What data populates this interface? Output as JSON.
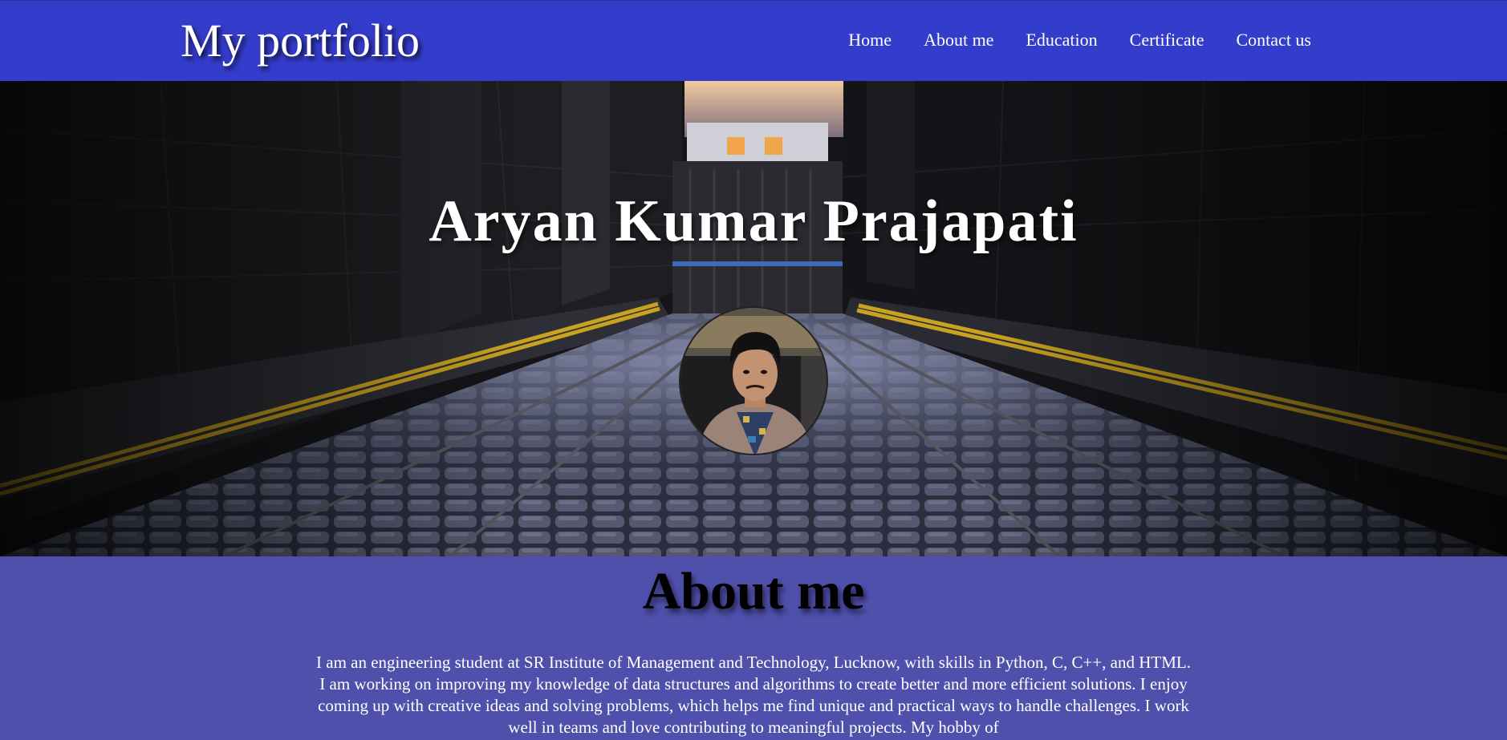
{
  "header": {
    "brand": "My portfolio",
    "nav": [
      {
        "label": "Home"
      },
      {
        "label": "About me"
      },
      {
        "label": "Education"
      },
      {
        "label": "Certificate"
      },
      {
        "label": "Contact us"
      }
    ]
  },
  "hero": {
    "name": "Aryan Kumar Prajapati"
  },
  "about": {
    "title": "About me",
    "text": "I am an engineering student at SR Institute of Management and Technology, Lucknow, with skills in Python, C, C++, and HTML. I am working on improving my knowledge of data structures and algorithms to create better and more efficient solutions. I enjoy coming up with creative ideas and solving problems, which helps me find unique and practical ways to handle challenges. I work well in teams and love contributing to meaningful projects. My hobby of"
  },
  "colors": {
    "navbar": "#343ccb",
    "about_bg": "#4f50ac",
    "road_line": "#c9a21f"
  }
}
